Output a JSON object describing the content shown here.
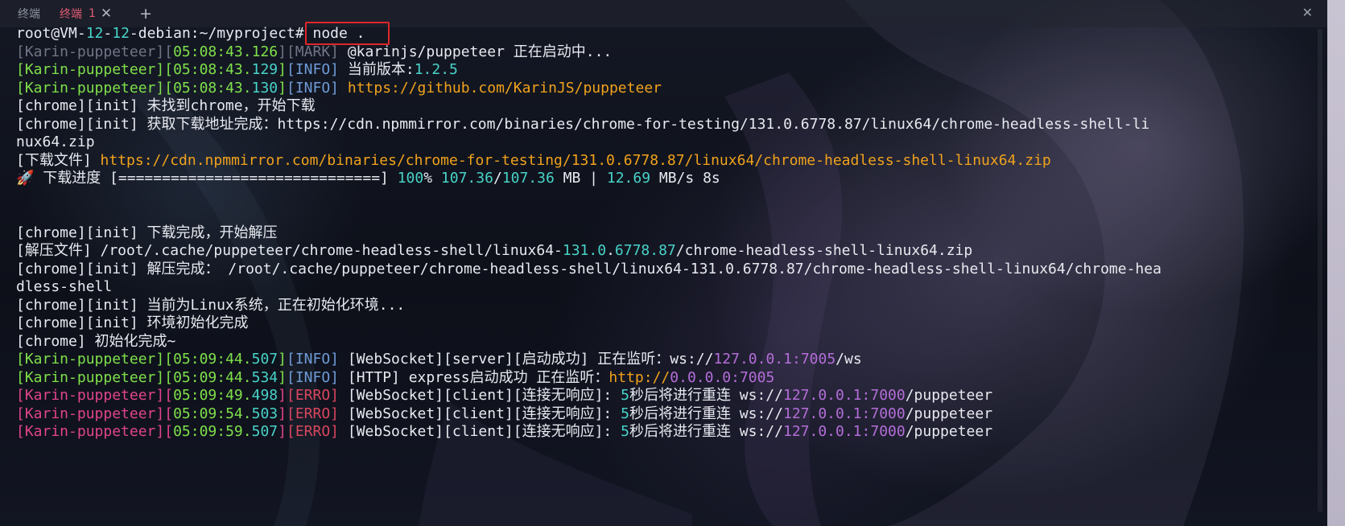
{
  "tabs": [
    {
      "label": "终端",
      "active": false
    },
    {
      "label": "终端",
      "number": "1",
      "active": true
    }
  ],
  "tab_add_label": "+",
  "window_close_label": "✕",
  "tab_close_label": "✕",
  "colors": {
    "accent_tab": "#e25b73",
    "green": "#7fe04a",
    "cyan": "#48d3c9",
    "orange": "#f0a21c",
    "pink": "#e0448c",
    "purple": "#b46ed8",
    "highlight_box": "#e0262b"
  },
  "terminal": {
    "lines": [
      [
        {
          "t": "root@VM-",
          "c": "white"
        },
        {
          "t": "12",
          "c": "cyan"
        },
        {
          "t": "-",
          "c": "white"
        },
        {
          "t": "12",
          "c": "cyan"
        },
        {
          "t": "-debian:~/myproject# node .",
          "c": "white"
        }
      ],
      [
        {
          "t": "[Karin-puppeteer]",
          "c": "gray"
        },
        {
          "t": "[",
          "c": "gray"
        },
        {
          "t": "05:08:43.126",
          "c": "green"
        },
        {
          "t": "]",
          "c": "gray"
        },
        {
          "t": "[MARK]",
          "c": "gray"
        },
        {
          "t": " @karinjs/puppeteer 正在启动中...",
          "c": "white"
        }
      ],
      [
        {
          "t": "[Karin-puppeteer]",
          "c": "green"
        },
        {
          "t": "[",
          "c": "green"
        },
        {
          "t": "05:08:43.",
          "c": "green"
        },
        {
          "t": "129",
          "c": "cyan"
        },
        {
          "t": "]",
          "c": "green"
        },
        {
          "t": "[INFO]",
          "c": "blue"
        },
        {
          "t": " 当前版本:",
          "c": "white"
        },
        {
          "t": "1.2.5",
          "c": "cyan"
        }
      ],
      [
        {
          "t": "[Karin-puppeteer]",
          "c": "green"
        },
        {
          "t": "[",
          "c": "green"
        },
        {
          "t": "05:08:43.",
          "c": "green"
        },
        {
          "t": "130",
          "c": "cyan"
        },
        {
          "t": "]",
          "c": "green"
        },
        {
          "t": "[INFO]",
          "c": "blue"
        },
        {
          "t": " ",
          "c": "white"
        },
        {
          "t": "https://github.com/KarinJS/puppeteer",
          "c": "orange"
        }
      ],
      [
        {
          "t": "[chrome][init] 未找到chrome，开始下载",
          "c": "white"
        }
      ],
      [
        {
          "t": "[chrome][init] 获取下载地址完成：https://cdn.npmmirror.com/binaries/chrome-for-testing/131.0.6778.87/linux64/chrome-headless-shell-li",
          "c": "white"
        }
      ],
      [
        {
          "t": "nux64.zip",
          "c": "white"
        }
      ],
      [
        {
          "t": "[下载文件] ",
          "c": "white"
        },
        {
          "t": "https://cdn.npmmirror.com/binaries/chrome-for-testing/131.0.6778.87/linux64/chrome-headless-shell-linux64.zip",
          "c": "orange"
        }
      ],
      [
        {
          "t": "🚀 下载进度 [==============================] ",
          "c": "white"
        },
        {
          "t": "100",
          "c": "cyan"
        },
        {
          "t": "% ",
          "c": "white"
        },
        {
          "t": "107.36",
          "c": "cyan"
        },
        {
          "t": "/",
          "c": "white"
        },
        {
          "t": "107.36",
          "c": "cyan"
        },
        {
          "t": " MB | ",
          "c": "white"
        },
        {
          "t": "12.69",
          "c": "cyan"
        },
        {
          "t": " MB/s 8s",
          "c": "white"
        }
      ],
      [],
      [],
      [
        {
          "t": "[chrome][init] 下载完成，开始解压",
          "c": "white"
        }
      ],
      [
        {
          "t": "[解压文件] /root/.cache/puppeteer/chrome-headless-shell/linux64-",
          "c": "white"
        },
        {
          "t": "131.0",
          "c": "cyan"
        },
        {
          "t": ".",
          "c": "white"
        },
        {
          "t": "6778.87",
          "c": "cyan"
        },
        {
          "t": "/chrome-headless-shell-linux64.zip",
          "c": "white"
        }
      ],
      [
        {
          "t": "[chrome][init] 解压完成： /root/.cache/puppeteer/chrome-headless-shell/linux64-131.0.6778.87/chrome-headless-shell-linux64/chrome-hea",
          "c": "white"
        }
      ],
      [
        {
          "t": "dless-shell",
          "c": "white"
        }
      ],
      [
        {
          "t": "[chrome][init] 当前为Linux系统，正在初始化环境...",
          "c": "white"
        }
      ],
      [
        {
          "t": "[chrome][init] 环境初始化完成",
          "c": "white"
        }
      ],
      [
        {
          "t": "[chrome] 初始化完成~",
          "c": "white"
        }
      ],
      [
        {
          "t": "[Karin-puppeteer]",
          "c": "green"
        },
        {
          "t": "[",
          "c": "green"
        },
        {
          "t": "05:09:44.",
          "c": "green"
        },
        {
          "t": "507",
          "c": "cyan"
        },
        {
          "t": "]",
          "c": "green"
        },
        {
          "t": "[INFO]",
          "c": "blue"
        },
        {
          "t": " [WebSocket][server][启动成功] 正在监听：ws://",
          "c": "white"
        },
        {
          "t": "127.0.0.1:7005",
          "c": "purple"
        },
        {
          "t": "/ws",
          "c": "white"
        }
      ],
      [
        {
          "t": "[Karin-puppeteer]",
          "c": "green"
        },
        {
          "t": "[",
          "c": "green"
        },
        {
          "t": "05:09:44.",
          "c": "green"
        },
        {
          "t": "534",
          "c": "cyan"
        },
        {
          "t": "]",
          "c": "green"
        },
        {
          "t": "[INFO]",
          "c": "blue"
        },
        {
          "t": " [HTTP] express启动成功 正在监听：",
          "c": "white"
        },
        {
          "t": "http://",
          "c": "orange"
        },
        {
          "t": "0.0.0.0:7005",
          "c": "purple"
        }
      ],
      [
        {
          "t": "[Karin-puppeteer]",
          "c": "pink"
        },
        {
          "t": "[",
          "c": "pink"
        },
        {
          "t": "05:09:49.",
          "c": "green"
        },
        {
          "t": "498",
          "c": "cyan"
        },
        {
          "t": "]",
          "c": "pink"
        },
        {
          "t": "[ERRO]",
          "c": "red"
        },
        {
          "t": " [WebSocket][client][连接无响应]: ",
          "c": "white"
        },
        {
          "t": "5",
          "c": "cyan"
        },
        {
          "t": "秒后将进行重连 ws://",
          "c": "white"
        },
        {
          "t": "127.0.0.1:7000",
          "c": "purple"
        },
        {
          "t": "/puppeteer",
          "c": "white"
        }
      ],
      [
        {
          "t": "[Karin-puppeteer]",
          "c": "pink"
        },
        {
          "t": "[",
          "c": "pink"
        },
        {
          "t": "05:09:54.",
          "c": "green"
        },
        {
          "t": "503",
          "c": "cyan"
        },
        {
          "t": "]",
          "c": "pink"
        },
        {
          "t": "[ERRO]",
          "c": "red"
        },
        {
          "t": " [WebSocket][client][连接无响应]: ",
          "c": "white"
        },
        {
          "t": "5",
          "c": "cyan"
        },
        {
          "t": "秒后将进行重连 ws://",
          "c": "white"
        },
        {
          "t": "127.0.0.1:7000",
          "c": "purple"
        },
        {
          "t": "/puppeteer",
          "c": "white"
        }
      ],
      [
        {
          "t": "[Karin-puppeteer]",
          "c": "pink"
        },
        {
          "t": "[",
          "c": "pink"
        },
        {
          "t": "05:09:59.",
          "c": "green"
        },
        {
          "t": "507",
          "c": "cyan"
        },
        {
          "t": "]",
          "c": "pink"
        },
        {
          "t": "[ERRO]",
          "c": "red"
        },
        {
          "t": " [WebSocket][client][连接无响应]: ",
          "c": "white"
        },
        {
          "t": "5",
          "c": "cyan"
        },
        {
          "t": "秒后将进行重连 ws://",
          "c": "white"
        },
        {
          "t": "127.0.0.1:7000",
          "c": "purple"
        },
        {
          "t": "/puppeteer",
          "c": "white"
        }
      ]
    ]
  }
}
